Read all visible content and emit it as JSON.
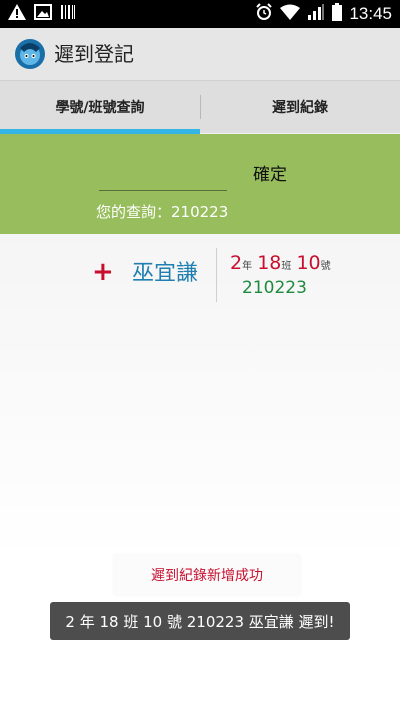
{
  "status_bar": {
    "time": "13:45",
    "icons": [
      "warning-icon",
      "image-icon",
      "barcode-icon",
      "alarm-icon",
      "wifi-icon",
      "signal-icon",
      "battery-icon"
    ]
  },
  "app": {
    "title": "遲到登記",
    "icon": "app-logo-icon"
  },
  "tabs": [
    {
      "label": "學號/班號查詢",
      "active": true
    },
    {
      "label": "遲到紀錄",
      "active": false
    }
  ],
  "query": {
    "input_value": "",
    "confirm_label": "確定",
    "result_text": "您的查詢：210223"
  },
  "record": {
    "add_symbol": "+",
    "name": "巫宜謙",
    "grade": "2",
    "grade_unit": "年",
    "class": "18",
    "class_unit": "班",
    "number": "10",
    "number_unit": "號",
    "student_id": "210223"
  },
  "toasts": {
    "success": "遲到紀錄新增成功",
    "late": "2 年 18 班 10 號  210223  巫宜謙 遲到!"
  },
  "colors": {
    "accent_blue": "#33b5e5",
    "panel_green": "#97bd5c",
    "red": "#c8102e",
    "name_blue": "#1f7fb0",
    "id_green": "#1e8a3e"
  }
}
